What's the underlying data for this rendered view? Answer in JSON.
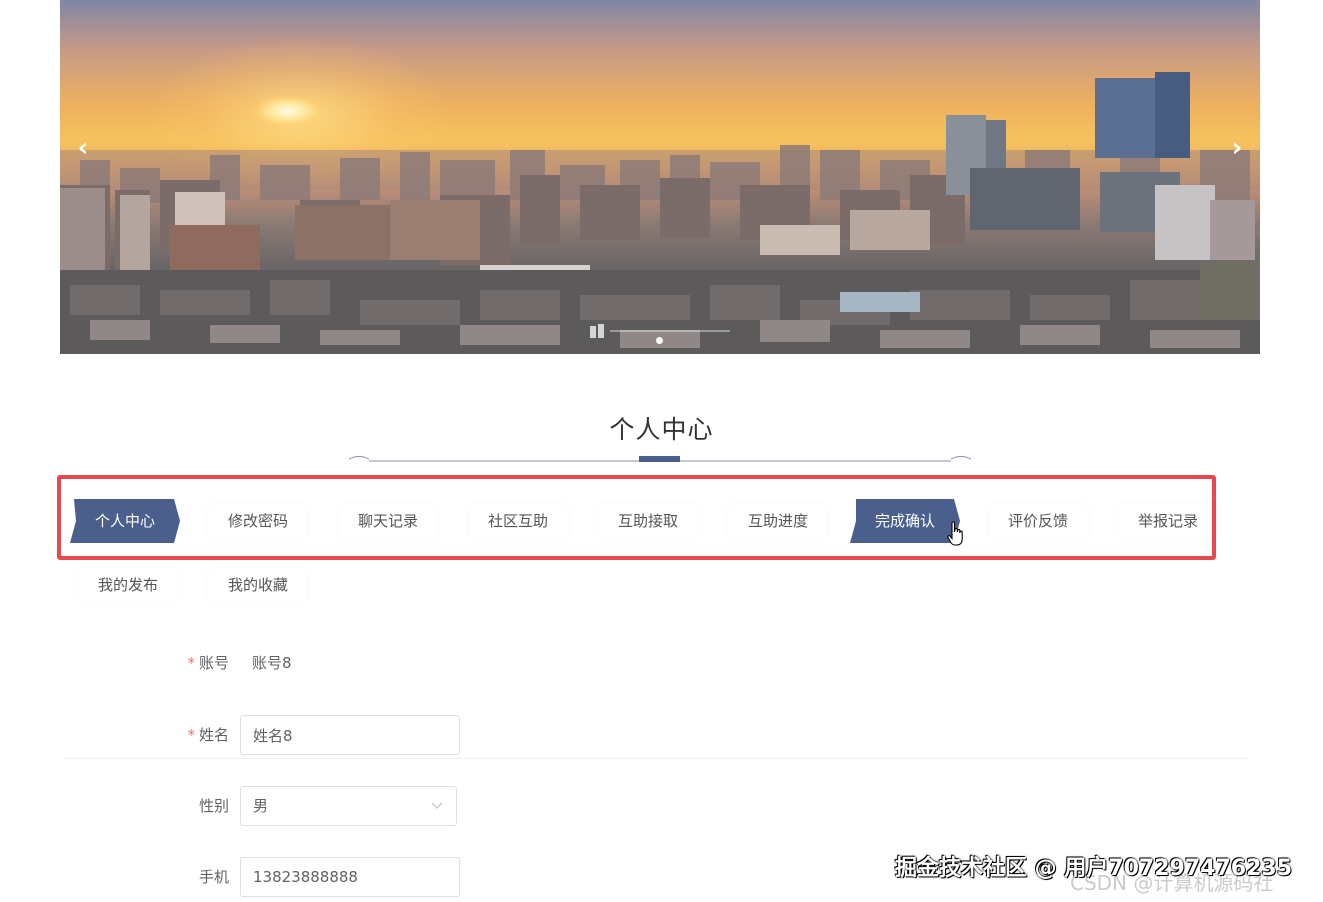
{
  "banner": {
    "prev_icon": "chevron-left-icon",
    "next_icon": "chevron-right-icon",
    "active_slide": 1,
    "slide_count": 1
  },
  "page": {
    "title": "个人中心"
  },
  "tabs": [
    {
      "label": "个人中心",
      "active": true
    },
    {
      "label": "修改密码",
      "active": false
    },
    {
      "label": "聊天记录",
      "active": false
    },
    {
      "label": "社区互助",
      "active": false
    },
    {
      "label": "互助接取",
      "active": false
    },
    {
      "label": "互助进度",
      "active": false
    },
    {
      "label": "完成确认",
      "active": true
    },
    {
      "label": "评价反馈",
      "active": false
    },
    {
      "label": "举报记录",
      "active": false
    },
    {
      "label": "我的发布",
      "active": false
    },
    {
      "label": "我的收藏",
      "active": false
    }
  ],
  "form": {
    "account": {
      "label": "账号",
      "required": "*",
      "value": "账号8"
    },
    "name": {
      "label": "姓名",
      "required": "*",
      "value": "姓名8"
    },
    "gender": {
      "label": "性别",
      "value": "男"
    },
    "phone": {
      "label": "手机",
      "value": "13823888888"
    }
  },
  "watermarks": {
    "primary": "掘金技术社区 @ 用户707297476235",
    "secondary": "CSDN @计算机源码社"
  },
  "colors": {
    "accent": "#4a5f8c",
    "highlight_border": "#e8484f",
    "required": "#f56c6c"
  }
}
